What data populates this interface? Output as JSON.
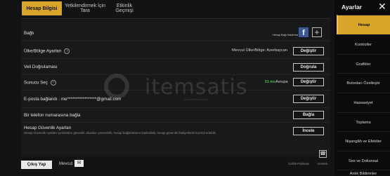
{
  "tabs": [
    {
      "label": "Hesap Bilgisi",
      "active": true
    },
    {
      "label": "Yetkilendirmek İçin Tara",
      "active": false
    },
    {
      "label": "Etkinlik Geçmişi",
      "active": false
    }
  ],
  "rows": {
    "bagli": {
      "label": "Bağlı",
      "fb_caption": "Hesap Bağı Kaldırma"
    },
    "country": {
      "label": "Ülke/Bölge Ayarları",
      "value": "Mevcut Ülke/Bölge: Azerbaycan",
      "button": "Değiştir"
    },
    "parent": {
      "label": "Veli Doğrulaması",
      "button": "Doğrula"
    },
    "server": {
      "label": "Sunucu Seç",
      "ping": "51 ms",
      "value": "Avrupa",
      "button": "Değiştir"
    },
    "email": {
      "label": "E-posta bağlandı : me*****************@gmail.com",
      "button": "Değiştir"
    },
    "phone": {
      "label": "Bir telefon numarasına bağla",
      "button": "Bağla"
    },
    "security": {
      "label": "Hesap Güvenlik Ayarları",
      "sub": "Hesap Güvenlik Ayarları içerisinden güvenlik cihazları yönetebilir, hesap bağlantılarını kaldırabilir, hesap güvenlik faaliyetlerini kontrol edebilir",
      "button": "İncele"
    }
  },
  "watermark": {
    "brand": "itemsatis",
    "sub": "www.itemsatis.com"
  },
  "footer": {
    "logout": "Çıkış Yap",
    "mail": "Mevcut",
    "privacy": "Gizlilik Politikası",
    "support": "Destek"
  },
  "sidebar": {
    "title": "Ayarlar",
    "items": [
      "Hesap",
      "Kontroller",
      "Grafikler",
      "Butonları Özelleştir",
      "Hassasiyet",
      "Toplama",
      "Nişangâh ve Efektler",
      "Ses ve Dokunsal",
      "Anlık Bildirimler"
    ]
  },
  "colors": {
    "accent": "#d9a62b",
    "facebook": "#3b5998",
    "ping": "#46c440"
  }
}
